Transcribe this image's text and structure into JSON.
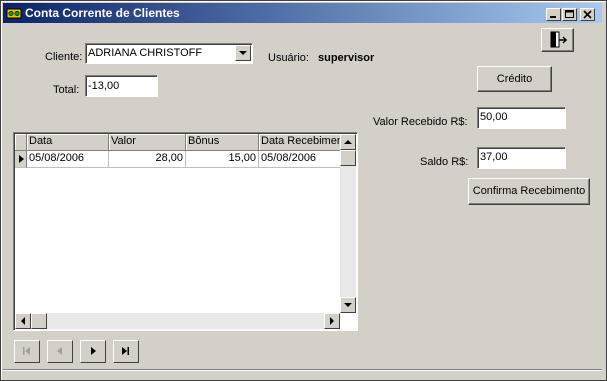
{
  "window": {
    "title": "Conta Corrente de Clientes",
    "title_icon": "app-icon"
  },
  "form": {
    "cliente_label": "Cliente:",
    "cliente_value": "ADRIANA CHRISTOFF",
    "usuario_label": "Usuário:",
    "usuario_value": "supervisor",
    "total_label": "Total:",
    "total_value": "-13,00",
    "valor_recebido_label": "Valor Recebido R$:",
    "valor_recebido_value": "50,00",
    "saldo_label": "Saldo R$:",
    "saldo_value": "37,00"
  },
  "buttons": {
    "credito": "Crédito",
    "confirma": "Confirma Recebimento",
    "exit_icon": "exit-door-icon"
  },
  "grid": {
    "columns": [
      "Data",
      "Valor",
      "Bônus",
      "Data Recebimento"
    ],
    "rows": [
      [
        "05/08/2006",
        "28,00",
        "15,00",
        "05/08/2006"
      ]
    ]
  },
  "navigator": {
    "icons": [
      "first-record-icon",
      "prior-record-icon",
      "next-record-icon",
      "last-record-icon"
    ]
  }
}
